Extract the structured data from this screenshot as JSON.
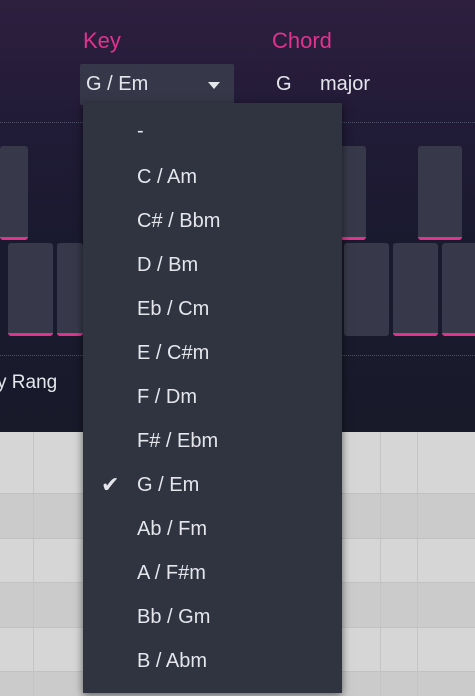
{
  "header": {
    "key_label": "Key",
    "chord_label": "Chord",
    "key_selected": "G / Em",
    "chord_root": "G",
    "chord_quality": "major",
    "range_label": "y Rang"
  },
  "key_menu": {
    "items": [
      {
        "label": "-",
        "selected": false
      },
      {
        "label": "C / Am",
        "selected": false
      },
      {
        "label": "C# / Bbm",
        "selected": false
      },
      {
        "label": "D / Bm",
        "selected": false
      },
      {
        "label": "Eb / Cm",
        "selected": false
      },
      {
        "label": "E / C#m",
        "selected": false
      },
      {
        "label": "F / Dm",
        "selected": false
      },
      {
        "label": "F# / Ebm",
        "selected": false
      },
      {
        "label": "G / Em",
        "selected": true
      },
      {
        "label": "Ab / Fm",
        "selected": false
      },
      {
        "label": "A / F#m",
        "selected": false
      },
      {
        "label": "Bb / Gm",
        "selected": false
      },
      {
        "label": "B / Abm",
        "selected": false
      }
    ],
    "check_glyph": "✔"
  },
  "colors": {
    "accent": "#e0338d",
    "menu_bg": "#2f3440",
    "header_bg": "#1a1a2f",
    "key_bg": "#37394a",
    "text": "#e4e6ec"
  }
}
